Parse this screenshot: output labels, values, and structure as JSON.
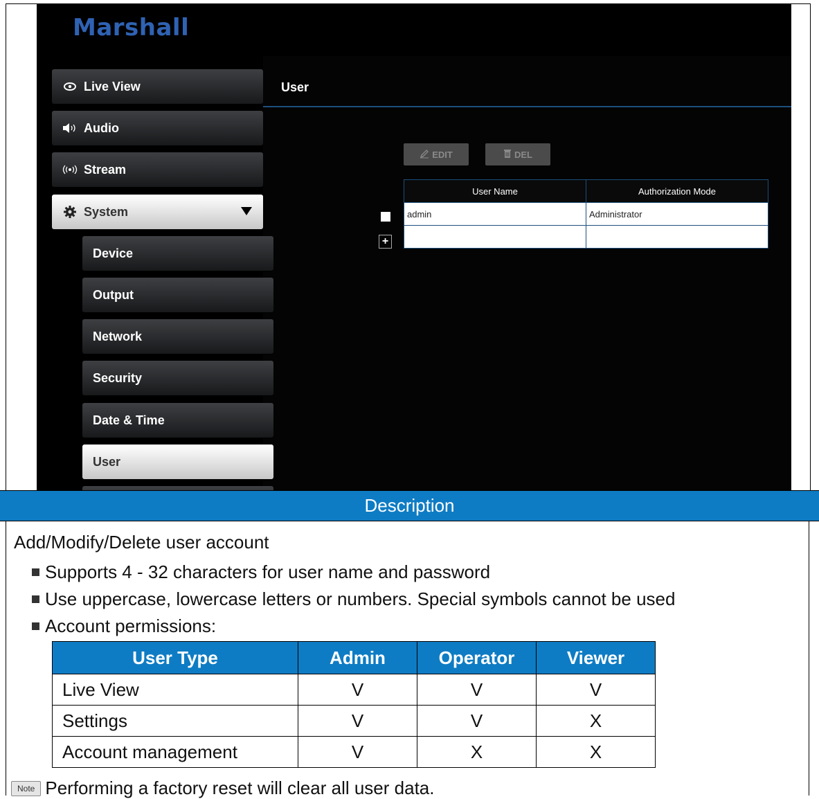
{
  "app": {
    "logo": "Marshall"
  },
  "sidebar": {
    "items": [
      {
        "label": "Live View",
        "icon": "eye-icon"
      },
      {
        "label": "Audio",
        "icon": "speaker-icon"
      },
      {
        "label": "Stream",
        "icon": "broadcast-icon"
      },
      {
        "label": "System",
        "icon": "gear-icon"
      }
    ],
    "subitems": [
      {
        "label": "Device"
      },
      {
        "label": "Output"
      },
      {
        "label": "Network"
      },
      {
        "label": "Security"
      },
      {
        "label": "Date & Time"
      },
      {
        "label": "User",
        "active": true
      }
    ]
  },
  "main": {
    "title": "User",
    "toolbar": {
      "edit_label": "EDIT",
      "del_label": "DEL"
    },
    "table": {
      "headers": [
        "User Name",
        "Authorization Mode"
      ],
      "rows": [
        [
          "admin",
          "Administrator"
        ]
      ],
      "add_label": "+"
    }
  },
  "description": {
    "header": "Description",
    "intro": "Add/Modify/Delete user account",
    "bullets": [
      "Supports 4 - 32 characters for user name and password",
      "Use uppercase, lowercase letters or numbers. Special symbols cannot be used",
      "Account permissions:"
    ],
    "permissions": {
      "headers": [
        "User Type",
        "Admin",
        "Operator",
        "Viewer"
      ],
      "rows": [
        [
          "Live View",
          "V",
          "V",
          "V"
        ],
        [
          "Settings",
          "V",
          "V",
          "X"
        ],
        [
          "Account management",
          "V",
          "X",
          "X"
        ]
      ]
    },
    "note_tag": "Note",
    "note_text": "Performing a factory reset will clear all user data."
  },
  "colors": {
    "accent": "#0e7cc4",
    "logo": "#2f62b3",
    "rule": "#1c4f7e"
  }
}
